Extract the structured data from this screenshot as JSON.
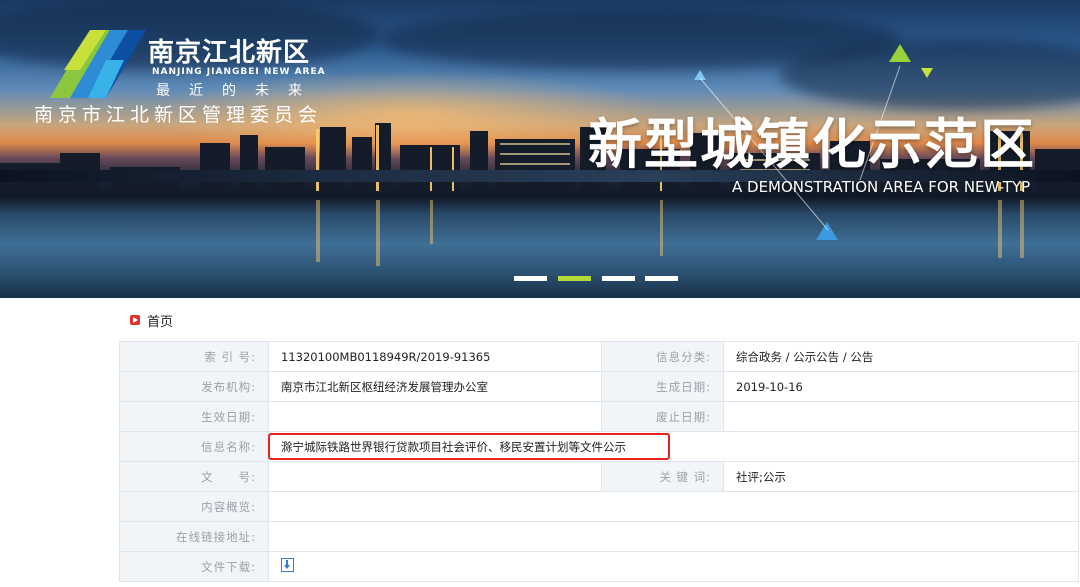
{
  "header": {
    "brand_cn": "南京江北新区",
    "brand_en": "NANJING JIANGBEI NEW AREA",
    "brand_tagline": "最近的未来",
    "org_name": "南京市江北新区管理委员会",
    "hero_title": "新型城镇化示范区",
    "hero_subtitle": "A DEMONSTRATION AREA FOR NEW-TYP",
    "slides_total": 4,
    "slide_active_index": 1
  },
  "breadcrumb": {
    "home_label": "首页"
  },
  "info": {
    "index_label": "索 引 号:",
    "index_value": "11320100MB0118949R/2019-91365",
    "category_label": "信息分类:",
    "category_value": "综合政务 / 公示公告 / 公告",
    "publisher_label": "发布机构:",
    "publisher_value": "南京市江北新区枢纽经济发展管理办公室",
    "created_label": "生成日期:",
    "created_value": "2019-10-16",
    "effective_label": "生效日期:",
    "effective_value": "",
    "abolished_label": "废止日期:",
    "abolished_value": "",
    "name_label": "信息名称:",
    "name_value": "滁宁城际铁路世界银行贷款项目社会评价、移民安置计划等文件公示",
    "docno_label": "文　　号:",
    "docno_value": "",
    "keywords_label": "关 键 词:",
    "keywords_value": "社评;公示",
    "summary_label": "内容概览:",
    "summary_value": "",
    "link_label": "在线链接地址:",
    "link_value": "",
    "download_label": "文件下载:"
  },
  "colors": {
    "highlight_border": "#e8231b",
    "label_bg": "#f2f5f8",
    "label_text": "#9aa1a9",
    "slide_active": "#b6d93a",
    "icon_red": "#e0352b",
    "download_blue": "#2f7fd3"
  },
  "icons": {
    "breadcrumb": "play-square-icon",
    "download": "download-icon"
  }
}
